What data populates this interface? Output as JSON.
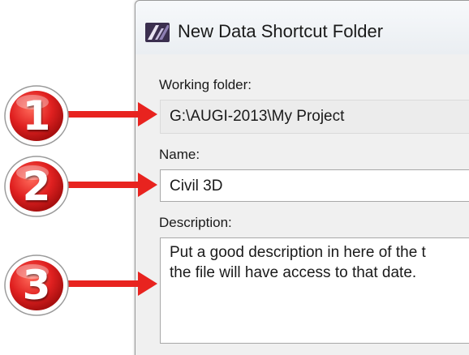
{
  "dialog": {
    "title": "New Data Shortcut Folder",
    "working_folder_label": "Working folder:",
    "working_folder_value": "G:\\AUGI-2013\\My Project",
    "name_label": "Name:",
    "name_value": "Civil 3D",
    "description_label": "Description:",
    "description_lines": [
      "Put a good description in here of the t",
      "the file will have access to that date.   "
    ]
  },
  "callouts": [
    "1",
    "2",
    "3"
  ],
  "colors": {
    "callout_red": "#e02020",
    "arrow_red": "#e8231f",
    "dialog_bg": "#f0f0f0",
    "field_border": "#a8a8a8"
  },
  "icons": {
    "app": "civil3d-app-icon"
  }
}
